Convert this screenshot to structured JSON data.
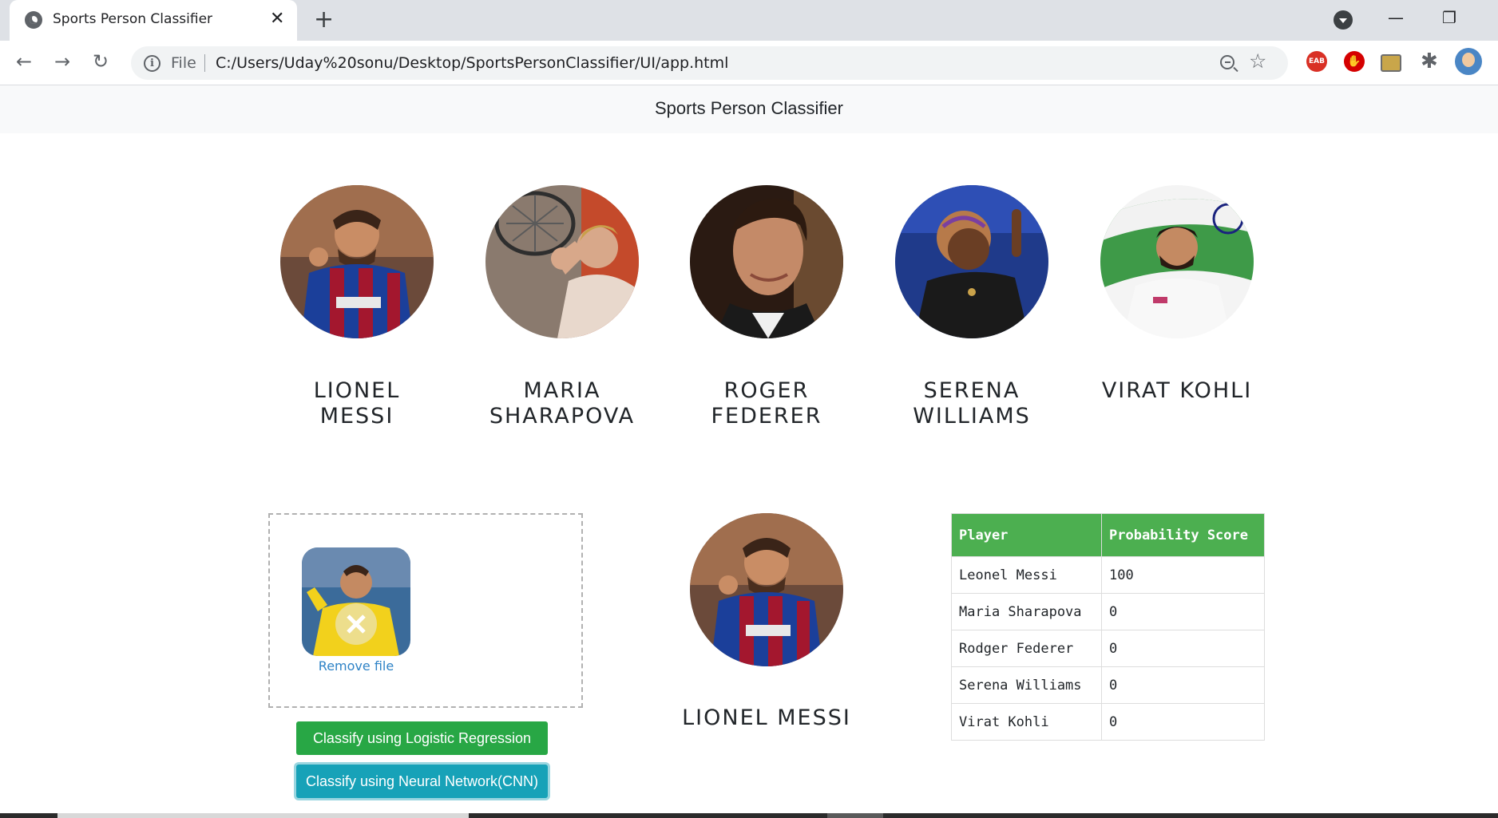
{
  "browser": {
    "tab_title": "Sports Person Classifier",
    "address_scheme": "File",
    "address_url": "C:/Users/Uday%20sonu/Desktop/SportsPersonClassifier/UI/app.html",
    "extensions": [
      "EAB",
      "stop-hand",
      "image",
      "puzzle"
    ]
  },
  "navbar": {
    "title": "Sports Person Classifier"
  },
  "players": [
    {
      "name": "LIONEL MESSI",
      "photo": "messi-photo"
    },
    {
      "name": "MARIA SHARAPOVA",
      "photo": "sharapova-photo"
    },
    {
      "name": "ROGER FEDERER",
      "photo": "federer-photo"
    },
    {
      "name": "SERENA WILLIAMS",
      "photo": "serena-photo"
    },
    {
      "name": "VIRAT KOHLI",
      "photo": "kohli-photo"
    }
  ],
  "upload": {
    "remove_label": "Remove file"
  },
  "buttons": {
    "logistic": "Classify using Logistic Regression",
    "cnn": "Classify using Neural Network(CNN)"
  },
  "result": {
    "name": "LIONEL MESSI"
  },
  "table": {
    "headers": [
      "Player",
      "Probability Score"
    ],
    "rows": [
      {
        "player": "Leonel Messi",
        "score": "100"
      },
      {
        "player": "Maria Sharapova",
        "score": "0"
      },
      {
        "player": "Rodger Federer",
        "score": "0"
      },
      {
        "player": "Serena Williams",
        "score": "0"
      },
      {
        "player": "Virat Kohli",
        "score": "0"
      }
    ]
  },
  "colors": {
    "table_header": "#4caf50",
    "btn_logistic": "#28a745",
    "btn_cnn": "#17a2b8"
  }
}
